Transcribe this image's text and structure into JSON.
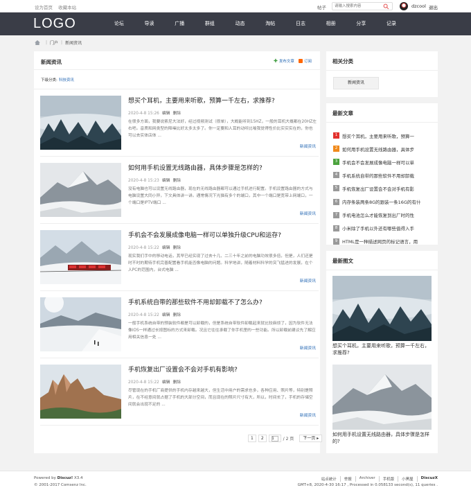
{
  "topbar": {
    "set_home": "设为首页",
    "bookmark": "收藏本站",
    "search_type": "帖子",
    "search_placeholder": "请输入搜索内容",
    "username": "dzcool",
    "logout": "退出"
  },
  "nav": {
    "logo": "LOGO",
    "items": [
      "论坛",
      "导读",
      "广播",
      "群组",
      "动态",
      "淘帖",
      "日志",
      "相册",
      "分享",
      "记录"
    ]
  },
  "breadcrumb": {
    "portal": "门户",
    "current": "新闻资讯"
  },
  "main": {
    "title": "新闻资讯",
    "post_article": "发布文章",
    "subscribe": "订阅",
    "subcat_label": "下级分类:",
    "subcat_link": "科技资讯",
    "articles": [
      {
        "title": "想买个耳机，主要用来听歌，预算一千左右，求推荐?",
        "date": "2020-4-8 15:26",
        "edit": "编辑",
        "delete": "删除",
        "summary": "在很多方面，我要说索尼大法好，经过视频测试（很单），大概能听到15HZ，一般的耳机大概都在20HZ左右吧。音质和网类型的降噪比好太多太多了。你一定要和人耳的动听比喻我觉得性价比实实实在的，你也可以去实体店体 ...",
        "category": "新闻资讯"
      },
      {
        "title": "如何用手机设置无线路由器，具体步骤是怎样的?",
        "date": "2020-4-8 15:23",
        "edit": "编辑",
        "delete": "删除",
        "summary": "没有电脑也可以设置无线路由器，现在的无线路由器都可以通过手机进行配置。手机设置路由器的方式与电脑设置大同小异，下文具体讲一讲。通常情况下光猫有多个的端口，其中一个端口是宽带上网端口，一个端口是IPTV端口 ...",
        "category": "新闻资讯"
      },
      {
        "title": "手机会不会发展成像电脑一样可以单独升级CPU和运存?",
        "date": "2020-4-8 15:22",
        "edit": "编辑",
        "delete": "删除",
        "summary": "现实我们手中的移动电话，其早已经实现了过去十几、二三十年之前的电脑功效很多倍，但是，人们还是时不时的期待手机完善配置看手机能否像电脑的问题。科学地讲，随着材料科学的突飞猛进的发展，在个人PC的范围内，台式电脑 ...",
        "category": "新闻资讯"
      },
      {
        "title": "手机系统自带的那些软件不用却卸载不了怎么办?",
        "date": "2020-4-8 15:22",
        "edit": "编辑",
        "delete": "删除",
        "summary": "一般手机系统自带的预装软件都是可以卸载的，但是系统自带软件卸载起来就比较麻烦了，因为软件无法像iOS一样通过长按图标的方式来卸载。况且它往往承载了你手机里的一些功能。所以卸载前建议先了解应用相关信息一处 ...",
        "category": "新闻资讯"
      },
      {
        "title": "手机恢复出厂设置会不会对手机有影响?",
        "date": "2020-4-8 15:22",
        "edit": "编辑",
        "delete": "删除",
        "summary": "尽管现在的手机厂商提供的手机内存越来越大，但生活中用户的需求也多，各种应用、照片等，特别是照片，在不经意间就占据了手机的大部分空间，而且现在的照片尺寸有大，所以，时间长了，手机的存储空间就会出现不足的 ...",
        "category": "新闻资讯"
      }
    ]
  },
  "pager": {
    "p1": "1",
    "p2": "2",
    "input": "1",
    "total": "/ 2 页",
    "next": "下一页"
  },
  "sidebar": {
    "related_title": "相关分类",
    "related_btn": "新闻资讯",
    "new_title": "最新文章",
    "new_items": [
      "想买个耳机，主要用来听歌，预算一",
      "如何用手机设置无线路由器，具体步",
      "手机会不会发展成像电脑一样可以单",
      "手机系统自带的那些软件不用却卸载",
      "手机恢复出厂设置会不会对手机有影",
      "内存条装两条8G的跟装一条16G的有什",
      "手机电池怎么才能恢复到出厂时的性",
      "小米除了手机以外还有哪些值得入手",
      "HTML是一种描述网页的标记语言，用"
    ],
    "num_colors": [
      "#e2312d",
      "#f08a1c",
      "#4ba33d",
      "#999999"
    ],
    "pics_title": "最新图文",
    "pics": [
      "想买个耳机，主要用来听歌，预算一千左右，求推荐?",
      "如何用手机设置无线路由器，具体步骤是怎样的?"
    ]
  },
  "footer": {
    "powered_by": "Powered by",
    "discuz": "Discuz!",
    "version": "X3.4",
    "copyright": "© 2001-2017 Comsenz Inc.",
    "links": [
      "站点统计",
      "举报",
      "Archiver",
      "手机版",
      "小黑屋",
      "DiscuzX"
    ],
    "info": "GMT+8, 2020-4-30 16:17 , Processed in 0.058133 second(s), 11 queries ."
  }
}
